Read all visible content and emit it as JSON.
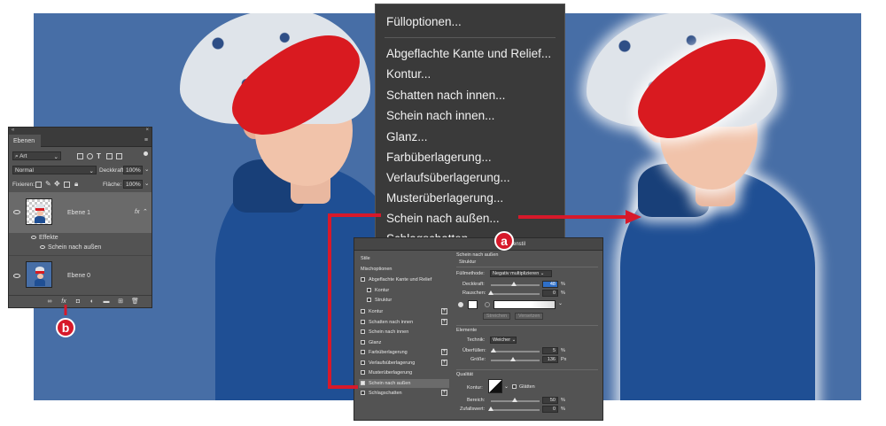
{
  "context_menu": {
    "items": [
      "Fülloptionen...",
      "Abgeflachte Kante und Relief...",
      "Kontur...",
      "Schatten nach innen...",
      "Schein nach innen...",
      "Glanz...",
      "Farbüberlagerung...",
      "Verlaufsüberlagerung...",
      "Musterüberlagerung...",
      "Schein nach außen...",
      "Schlagschatten..."
    ]
  },
  "layers_panel": {
    "tab": "Ebenen",
    "filter_kind": "Art",
    "blend_mode": "Normal",
    "opacity_label": "Deckkraft:",
    "opacity_value": "100%",
    "lock_label": "Fixieren:",
    "fill_label": "Fläche:",
    "fill_value": "100%",
    "layers": [
      {
        "name": "Ebene 1",
        "selected": true,
        "fx": "fx"
      },
      {
        "name": "Ebene 0",
        "selected": false
      }
    ],
    "effects_label": "Effekte",
    "effect_item": "Schein nach außen",
    "fx_button": "fx"
  },
  "layer_style_dialog": {
    "title": "Ebenenstil",
    "styles_header": "Stile",
    "blend_options": "Mischoptionen",
    "list": [
      {
        "label": "Abgeflachte Kante und Relief",
        "checked": false,
        "plus": false,
        "sub": false
      },
      {
        "label": "Kontur",
        "checked": false,
        "plus": false,
        "sub": true
      },
      {
        "label": "Struktur",
        "checked": false,
        "plus": false,
        "sub": true
      },
      {
        "label": "Kontur",
        "checked": false,
        "plus": true,
        "sub": false
      },
      {
        "label": "Schatten nach innen",
        "checked": false,
        "plus": true,
        "sub": false
      },
      {
        "label": "Schein nach innen",
        "checked": false,
        "plus": false,
        "sub": false
      },
      {
        "label": "Glanz",
        "checked": false,
        "plus": false,
        "sub": false
      },
      {
        "label": "Farbüberlagerung",
        "checked": false,
        "plus": true,
        "sub": false
      },
      {
        "label": "Verlaufsüberlagerung",
        "checked": false,
        "plus": true,
        "sub": false
      },
      {
        "label": "Musterüberlagerung",
        "checked": false,
        "plus": false,
        "sub": false
      },
      {
        "label": "Schein nach außen",
        "checked": true,
        "plus": false,
        "sub": false,
        "selected": true
      },
      {
        "label": "Schlagschatten",
        "checked": false,
        "plus": true,
        "sub": false
      }
    ],
    "section_title": "Schein nach außen",
    "struct_title": "Struktur",
    "fill_method_label": "Füllmethode:",
    "fill_method_value": "Negativ multiplizieren",
    "opacity_label": "Deckkraft:",
    "opacity_value": "48",
    "noise_label": "Rauschen:",
    "noise_value": "0",
    "percent": "%",
    "btn_stretch": "Streichen",
    "btn_reset": "Versetzen",
    "elements_title": "Elemente",
    "technique_label": "Technik:",
    "technique_value": "Weicher",
    "spread_label": "Überfüllen:",
    "spread_value": "5",
    "size_label": "Größe:",
    "size_value": "136",
    "px": "Px",
    "quality_title": "Qualität",
    "contour_label": "Kontur:",
    "smooth_label": "Glätten",
    "range_label": "Bereich:",
    "range_value": "50",
    "jitter_label": "Zufallswert:",
    "jitter_value": "0"
  },
  "badges": {
    "a": "a",
    "b": "b"
  },
  "colors": {
    "annotation": "#d7192a",
    "photo_bg": "#476ea6",
    "menu_bg": "#3a3a3a"
  }
}
